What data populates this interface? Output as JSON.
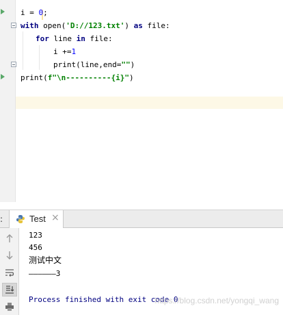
{
  "editor": {
    "lines": {
      "l1": {
        "name": "i",
        "op": " = ",
        "num": "0",
        "semi": ";"
      },
      "l2": {
        "kw_with": "with",
        "open": " open(",
        "str": "'D://123.txt'",
        "rest": ") ",
        "kw_as": "as",
        "tail": " file:"
      },
      "l3": {
        "kw_for": "for",
        "rest1": " line ",
        "kw_in": "in",
        "tail": " file:"
      },
      "l4": {
        "name": "i ",
        "op": "+=",
        "num": "1"
      },
      "l5": {
        "text": "print(line,end=",
        "str": "\"\"",
        "close": ")"
      },
      "l6": {
        "text": "print(",
        "str": "f\"\\n----------{i}\"",
        "close": ")"
      }
    }
  },
  "run_panel": {
    "tab_label": "Test",
    "tab_separator": ":",
    "tab_icon": "python-icon",
    "close_glyph": "×",
    "tools": [
      "arrow-up-icon",
      "arrow-down-icon",
      "soft-wrap-icon",
      "scroll-to-end-icon",
      "print-icon"
    ]
  },
  "console": {
    "lines": [
      "123",
      "456",
      "测试中文",
      "——————3"
    ],
    "exit_message": "Process finished with exit code 0"
  },
  "watermark": "https://blog.csdn.net/yongqi_wang",
  "colors": {
    "keyword": "#000080",
    "number": "#0000ff",
    "string": "#008000",
    "run_marker": "#59a869"
  }
}
